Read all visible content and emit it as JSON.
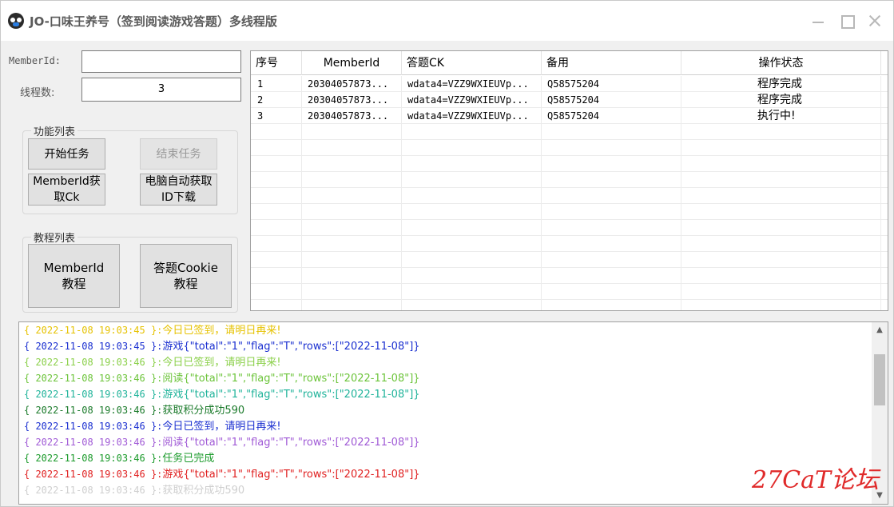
{
  "window": {
    "title": "JO-口味王养号（签到阅读游戏答题）多线程版"
  },
  "form": {
    "member_label": "MemberId:",
    "member_value": "",
    "threads_label": "线程数:",
    "threads_value": "3"
  },
  "func_group": {
    "title": "功能列表",
    "start_label": "开始任务",
    "stop_label": "结束任务",
    "getck_label_1": "MemberId获",
    "getck_label_2": "取Ck",
    "autoget_label_1": "电脑自动获取",
    "autoget_label_2": "ID下载"
  },
  "tutorial_group": {
    "title": "教程列表",
    "member_tut_1": "MemberId",
    "member_tut_2": "教程",
    "cookie_tut_1": "答题Cookie",
    "cookie_tut_2": "教程"
  },
  "grid": {
    "headers": [
      "序号",
      "MemberId",
      "答题CK",
      "备用",
      "操作状态"
    ],
    "rows": [
      [
        "1",
        "20304057873...",
        "wdata4=VZZ9WXIEUVp...",
        "Q58575204",
        "程序完成"
      ],
      [
        "2",
        "20304057873...",
        "wdata4=VZZ9WXIEUVp...",
        "Q58575204",
        "程序完成"
      ],
      [
        "3",
        "20304057873...",
        "wdata4=VZZ9WXIEUVp...",
        "Q58575204",
        "执行中!"
      ]
    ]
  },
  "log": {
    "lines": [
      {
        "prefix": "{ 2022-11-08 19:03:45 }:",
        "text": "今日已签到，请明日再来!",
        "color": "#e6c200"
      },
      {
        "prefix": "{ 2022-11-08 19:03:45 }:",
        "text": "游戏{\"total\":\"1\",\"flag\":\"T\",\"rows\":[\"2022-11-08\"]}",
        "color": "#1a2fd0"
      },
      {
        "prefix": "{ 2022-11-08 19:03:46 }:",
        "text": "今日已签到，请明日再来!",
        "color": "#8bd04a"
      },
      {
        "prefix": "{ 2022-11-08 19:03:46 }:",
        "text": "阅读{\"total\":\"1\",\"flag\":\"T\",\"rows\":[\"2022-11-08\"]}",
        "color": "#6cc43a"
      },
      {
        "prefix": "{ 2022-11-08 19:03:46 }:",
        "text": "游戏{\"total\":\"1\",\"flag\":\"T\",\"rows\":[\"2022-11-08\"]}",
        "color": "#1fb39a"
      },
      {
        "prefix": "{ 2022-11-08 19:03:46 }:",
        "text": "获取积分成功590",
        "color": "#1a7a2a"
      },
      {
        "prefix": "{ 2022-11-08 19:03:46 }:",
        "text": "今日已签到，请明日再来!",
        "color": "#1a2fd0"
      },
      {
        "prefix": "{ 2022-11-08 19:03:46 }:",
        "text": "阅读{\"total\":\"1\",\"flag\":\"T\",\"rows\":[\"2022-11-08\"]}",
        "color": "#a05ad6"
      },
      {
        "prefix": "{ 2022-11-08 19:03:46 }:",
        "text": "任务已完成",
        "color": "#1a9a2a"
      },
      {
        "prefix": "{ 2022-11-08 19:03:46 }:",
        "text": "游戏{\"total\":\"1\",\"flag\":\"T\",\"rows\":[\"2022-11-08\"]}",
        "color": "#e02020"
      },
      {
        "prefix": "{ 2022-11-08 19:03:46 }:",
        "text": "获取积分成功590",
        "color": "#cfcfcf"
      }
    ]
  },
  "watermark": "27CaT论坛",
  "icons": {
    "app": "panda-icon",
    "minimize": "minimize-icon",
    "maximize": "maximize-icon",
    "close": "close-icon",
    "scroll_up": "scroll-up-icon",
    "scroll_down": "scroll-down-icon"
  }
}
